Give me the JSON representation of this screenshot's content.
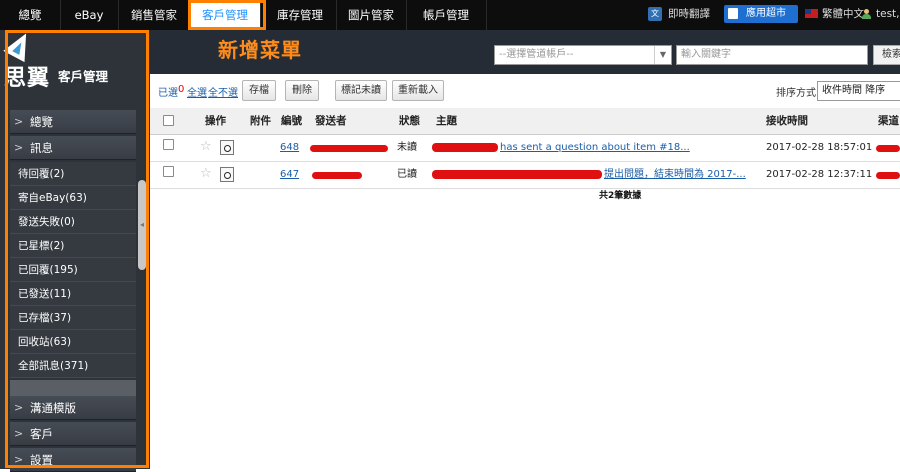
{
  "topnav": {
    "items": [
      "總覽",
      "eBay",
      "銷售管家",
      "客戶管理",
      "庫存管理",
      "圖片管家",
      "帳戶管理"
    ],
    "active_index": 3,
    "translate_icon": "translate-icon",
    "translate_label": "即時翻譯",
    "market_label": "應用超市",
    "language_label": "繁體中文",
    "user_label": "test, r"
  },
  "header": {
    "menu_title": "新增菜單",
    "account_placeholder": "--選擇管道帳戶--",
    "keyword_placeholder": "輸入關鍵字",
    "search_label": "檢索"
  },
  "sidebar": {
    "logo_text": "思翼",
    "logo_sub": "客戶管理",
    "overview_label": "總覽",
    "message_label": "訊息",
    "message_items": [
      "待回覆(2)",
      "寄自eBay(63)",
      "發送失敗(0)",
      "已星標(2)",
      "已回覆(195)",
      "已發送(11)",
      "已存檔(37)",
      "回收站(63)",
      "全部訊息(371)"
    ],
    "bottom_sections": [
      "溝通模版",
      "客戶",
      "設置"
    ]
  },
  "toolbar": {
    "selected_label": "已選",
    "selected_count": "0",
    "select_all": "全選",
    "select_none": "全不選",
    "archive": "存檔",
    "delete": "刪除",
    "mark_unread": "標記未讀",
    "reload": "重新載入",
    "sort_label": "排序方式",
    "sort_value": "收件時間 降序"
  },
  "table": {
    "headers": [
      "操作",
      "附件",
      "編號",
      "發送者",
      "狀態",
      "主題",
      "接收時間",
      "渠道"
    ],
    "rows": [
      {
        "id": "648",
        "status": "未讀",
        "subject_visible": "has sent a question about item #18...",
        "time": "2017-02-28 18:57:01"
      },
      {
        "id": "647",
        "status": "已讀",
        "subject_visible": "提出問題，結束時間為 2017-...",
        "time": "2017-02-28 12:37:11"
      }
    ],
    "count_text": "共2筆數據"
  },
  "colors": {
    "highlight": "#ff7f00",
    "accent": "#1e90ff",
    "sidebar_bg": "#2e333a",
    "header_band": "#252c36"
  }
}
